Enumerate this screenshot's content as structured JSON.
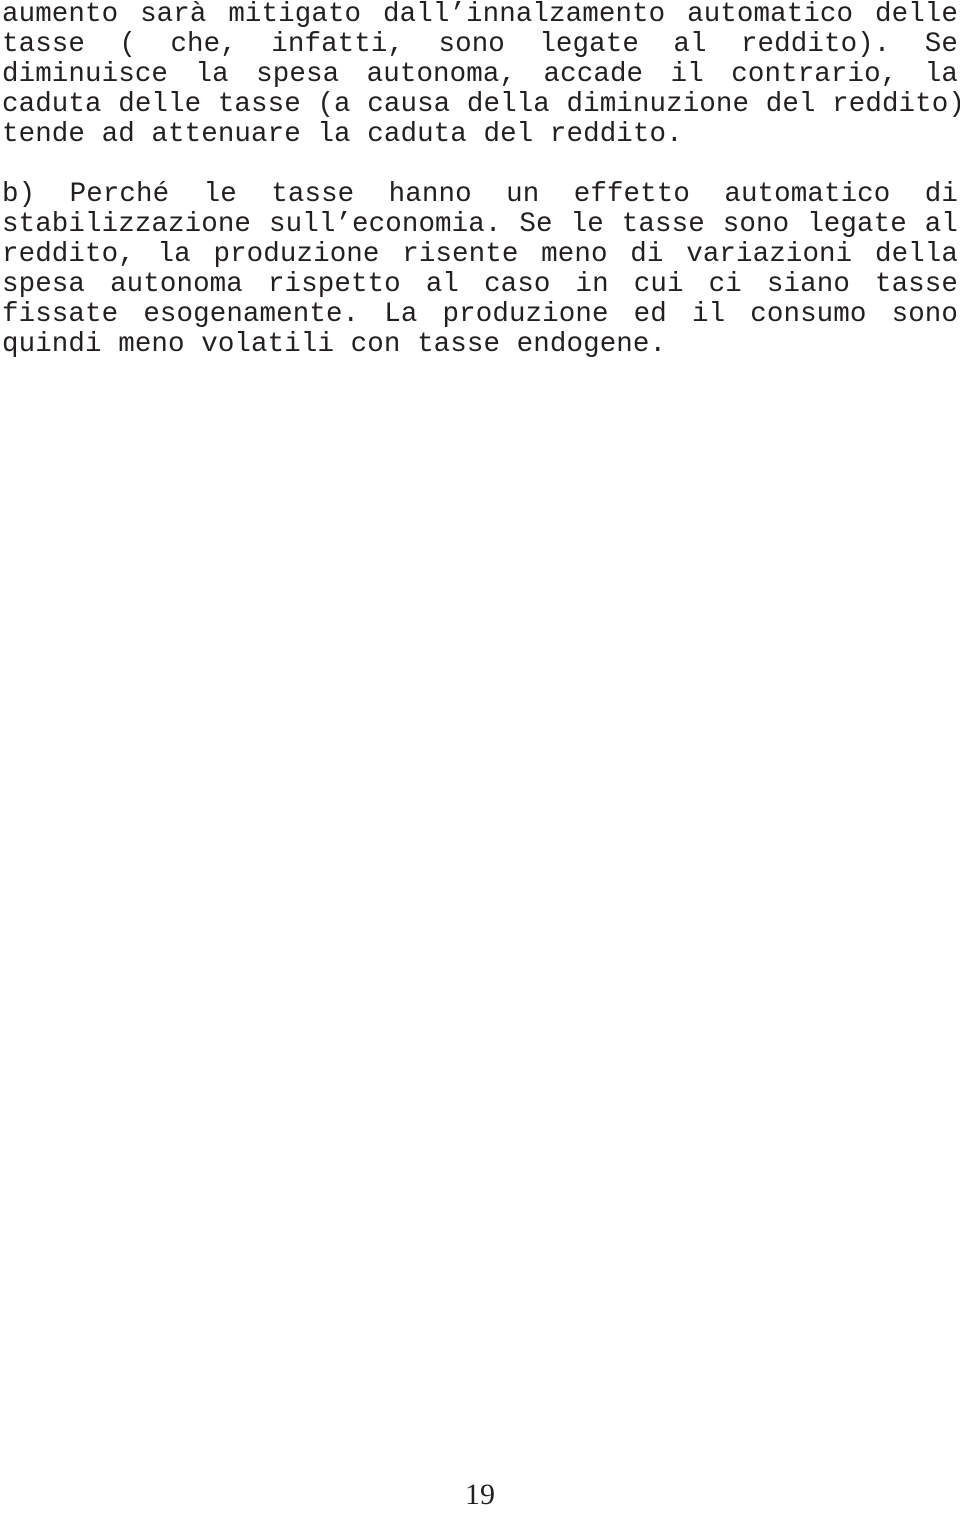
{
  "document": {
    "language": "it",
    "page_number": "19",
    "background_color": "#ffffff",
    "text_color": "#231f20"
  },
  "content": {
    "paragraph_1": {
      "full_text": "aumento sarà mitigato dall’innalzamento automatico delle tasse ( che, infatti, sono legate al reddito). Se diminuisce la spesa autonoma, accade il contrario, la caduta delle tasse (a causa della diminuzione del reddito) tende ad attenuare la caduta del reddito.",
      "lines": [
        "aumento sarà mitigato dall’innalzamento automatico delle",
        "tasse ( che, infatti, sono legate al reddito). Se",
        "diminuisce la spesa autonoma, accade il contrario, la",
        "caduta delle tasse (a causa della diminuzione del reddito)",
        "tende ad attenuare la caduta del reddito."
      ]
    },
    "paragraph_2": {
      "full_text": "b) Perché le tasse hanno un effetto automatico di stabilizzazione sull’economia. Se le tasse sono legate al reddito, la produzione risente meno di variazioni della spesa autonoma rispetto al caso in cui ci siano tasse fissate esogenamente. La produzione ed il consumo sono quindi meno volatili con tasse endogene.",
      "lines": [
        "b) Perché le tasse hanno un effetto automatico di",
        "stabilizzazione sull’economia. Se le tasse sono legate al",
        "reddito, la produzione risente meno di variazioni della",
        "spesa autonoma rispetto al caso in cui ci siano tasse",
        "fissate esogenamente. La produzione ed il consumo sono",
        "quindi meno volatili con tasse endogene."
      ]
    }
  },
  "footer": {
    "page_number_label": "19"
  }
}
